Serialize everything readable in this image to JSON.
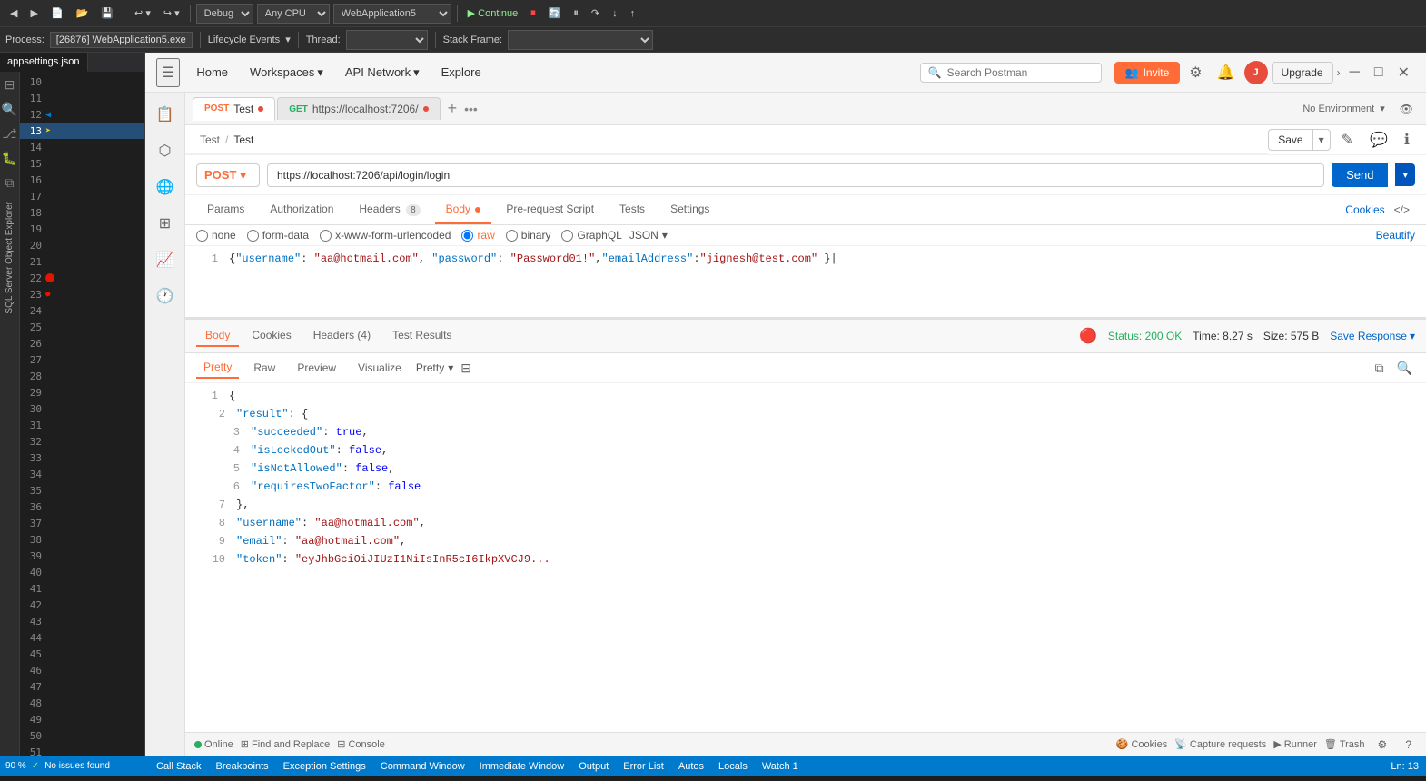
{
  "vstoolbar": {
    "buttons": [
      "◀",
      "▶",
      "⟲",
      "⟳"
    ],
    "debug_mode": "Debug",
    "cpu": "Any CPU",
    "app": "WebApplication5",
    "continue": "Continue",
    "process": "[26876] WebApplication5.exe",
    "lifecycle": "Lifecycle Events",
    "thread_label": "Thread:",
    "stackframe_label": "Stack Frame:"
  },
  "postman": {
    "nav": {
      "menu_icon": "☰",
      "home": "Home",
      "workspaces": "Workspaces",
      "api_network": "API Network",
      "explore": "Explore",
      "search_placeholder": "Search Postman",
      "invite": "Invite",
      "upgrade": "Upgrade",
      "no_env": "No Environment"
    },
    "tabs": [
      {
        "method": "POST",
        "name": "Test",
        "dot": true,
        "active": true
      },
      {
        "method": "GET",
        "name": "https://localhost:7206/",
        "dot": true,
        "active": false
      }
    ],
    "tab_add": "+",
    "tab_more": "•••",
    "breadcrumb": {
      "parent": "Test",
      "sep": "/",
      "current": "Test"
    },
    "actions": {
      "save": "Save",
      "edit_icon": "✎",
      "comment_icon": "💬",
      "info_icon": "ℹ"
    },
    "request": {
      "method": "POST",
      "url": "https://localhost:7206/api/login/login",
      "send": "Send",
      "tabs": [
        {
          "label": "Params"
        },
        {
          "label": "Authorization"
        },
        {
          "label": "Headers",
          "badge": "8"
        },
        {
          "label": "Body",
          "dot": true,
          "active": true
        },
        {
          "label": "Pre-request Script"
        },
        {
          "label": "Tests"
        },
        {
          "label": "Settings"
        }
      ],
      "cookies_link": "Cookies",
      "code_icon": "</>",
      "body_formats": [
        {
          "label": "none",
          "value": "none"
        },
        {
          "label": "form-data",
          "value": "form-data"
        },
        {
          "label": "x-www-form-urlencoded",
          "value": "x-www-form-urlencoded"
        },
        {
          "label": "raw",
          "value": "raw",
          "active": true,
          "color": "#ff6c37"
        },
        {
          "label": "binary",
          "value": "binary"
        },
        {
          "label": "GraphQL",
          "value": "graphql"
        }
      ],
      "json_select": "JSON",
      "beautify": "Beautify",
      "body_code": "{\"username\": \"aa@hotmail.com\", \"password\": \"Password01!\",\"emailAddress\":\"jignesh@test.com\" }"
    },
    "response": {
      "tabs": [
        {
          "label": "Body",
          "active": true
        },
        {
          "label": "Cookies"
        },
        {
          "label": "Headers",
          "badge": "4"
        },
        {
          "label": "Test Results"
        }
      ],
      "status": "Status: 200 OK",
      "time": "Time: 8.27 s",
      "size": "Size: 575 B",
      "save_response": "Save Response",
      "formats": [
        {
          "label": "Pretty",
          "active": true
        },
        {
          "label": "Raw"
        },
        {
          "label": "Preview"
        },
        {
          "label": "Visualize"
        }
      ],
      "json_type": "JSON",
      "body_lines": [
        {
          "num": 1,
          "indent": 0,
          "content": "{",
          "type": "bracket"
        },
        {
          "num": 2,
          "indent": 1,
          "content": "\"result\": {",
          "keys": [
            "result"
          ]
        },
        {
          "num": 3,
          "indent": 2,
          "content": "\"succeeded\": true,",
          "key": "succeeded",
          "val": "true",
          "valtype": "bool"
        },
        {
          "num": 4,
          "indent": 2,
          "content": "\"isLockedOut\": false,",
          "key": "isLockedOut",
          "val": "false",
          "valtype": "bool"
        },
        {
          "num": 5,
          "indent": 2,
          "content": "\"isNotAllowed\": false,",
          "key": "isNotAllowed",
          "val": "false",
          "valtype": "bool"
        },
        {
          "num": 6,
          "indent": 2,
          "content": "\"requiresTwoFactor\": false",
          "key": "requiresTwoFactor",
          "val": "false",
          "valtype": "bool"
        },
        {
          "num": 7,
          "indent": 1,
          "content": "},",
          "type": "bracket"
        },
        {
          "num": 8,
          "indent": 1,
          "content": "\"username\": \"aa@hotmail.com\",",
          "key": "username",
          "val": "aa@hotmail.com",
          "valtype": "str"
        },
        {
          "num": 9,
          "indent": 1,
          "content": "\"email\": \"aa@hotmail.com\",",
          "key": "email",
          "val": "aa@hotmail.com",
          "valtype": "str"
        },
        {
          "num": 10,
          "indent": 1,
          "content": "\"token\": \"eyJhbGciOiJIUzI1NiIsInR5cI6IkpXVCJ9...",
          "key": "token",
          "valtype": "str_truncated"
        }
      ]
    },
    "statusbar": {
      "online": "Online",
      "find_replace": "Find and Replace",
      "console": "Console",
      "cookies": "Cookies",
      "capture": "Capture requests",
      "runner": "Runner",
      "trash": "Trash"
    }
  },
  "vs": {
    "explorer_tab": "appsettings.json",
    "project": "WebApplication5",
    "line_numbers": [
      10,
      11,
      12,
      13,
      14,
      15,
      16,
      17,
      18,
      19,
      20,
      21,
      22,
      23,
      24,
      25,
      26,
      27,
      28,
      29,
      30,
      31,
      32,
      33,
      34,
      35,
      36,
      37,
      38,
      39,
      40,
      41,
      42,
      43,
      44,
      45,
      46,
      47,
      48,
      49,
      50,
      51
    ],
    "active_line": 22,
    "breakpoint_line": 22,
    "bottombar": {
      "zoom": "90 %",
      "no_issues": "No issues found",
      "ln": "Ln: 13"
    },
    "debugtabs": [
      "Call Stack",
      "Breakpoints",
      "Exception Settings",
      "Command Window",
      "Immediate Window",
      "Output",
      "Error List",
      "Autos",
      "Locals",
      "Watch 1"
    ]
  }
}
